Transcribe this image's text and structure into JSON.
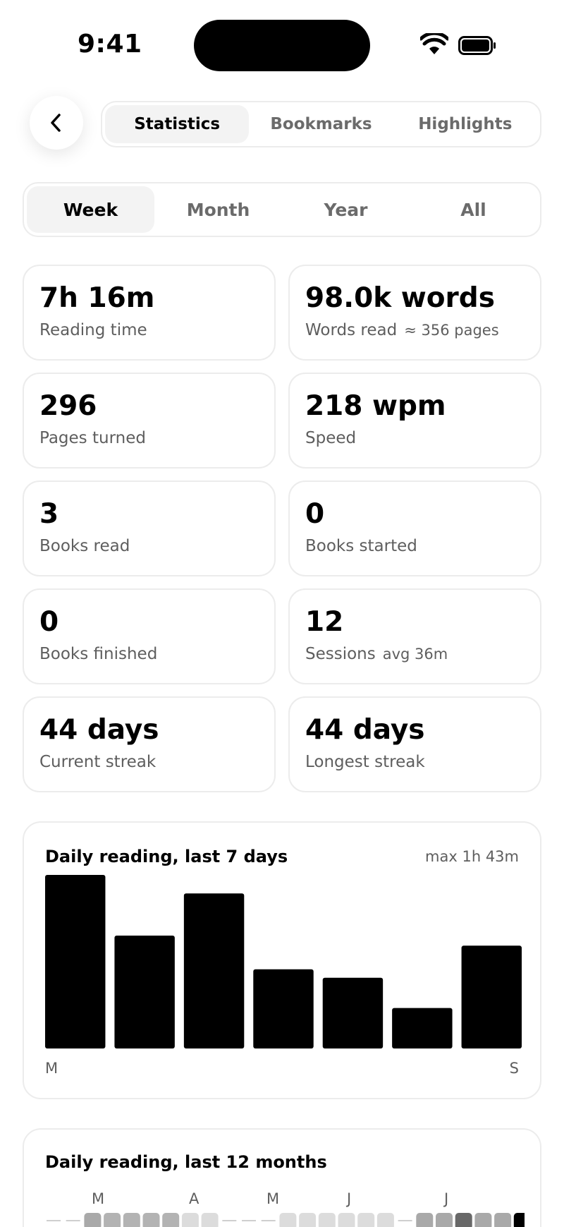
{
  "status_bar": {
    "time": "9:41"
  },
  "tabs": [
    {
      "label": "Statistics",
      "active": true
    },
    {
      "label": "Bookmarks",
      "active": false
    },
    {
      "label": "Highlights",
      "active": false
    }
  ],
  "periods": [
    {
      "label": "Week",
      "active": true
    },
    {
      "label": "Month",
      "active": false
    },
    {
      "label": "Year",
      "active": false
    },
    {
      "label": "All",
      "active": false
    }
  ],
  "stats": {
    "reading_time": {
      "value": "7h 16m",
      "label": "Reading time"
    },
    "words_read": {
      "value": "98.0k words",
      "label": "Words read",
      "sub": "≈ 356 pages"
    },
    "pages_turned": {
      "value": "296",
      "label": "Pages turned"
    },
    "speed": {
      "value": "218 wpm",
      "label": "Speed"
    },
    "books_read": {
      "value": "3",
      "label": "Books read"
    },
    "books_started": {
      "value": "0",
      "label": "Books started"
    },
    "books_finished": {
      "value": "0",
      "label": "Books finished"
    },
    "sessions": {
      "value": "12",
      "label": "Sessions",
      "sub": "avg 36m"
    },
    "current_streak": {
      "value": "44 days",
      "label": "Current streak"
    },
    "longest_streak": {
      "value": "44 days",
      "label": "Longest streak"
    }
  },
  "chart_data": {
    "type": "bar",
    "title": "Daily reading, last 7 days",
    "annotation": "max 1h 43m",
    "x_start_label": "M",
    "x_end_label": "S",
    "max_minutes": 103,
    "values_minutes": [
      103,
      67,
      92,
      47,
      42,
      24,
      61
    ],
    "bar_color": "#000000"
  },
  "heatmap": {
    "title": "Daily reading, last 12 months",
    "month_labels": [
      "M",
      "A",
      "M",
      "J",
      "J"
    ],
    "cells": [
      "dash",
      "dash",
      "#a9a9a9",
      "#b3b3b3",
      "#b3b3b3",
      "#b3b3b3",
      "#b3b3b3",
      "#dcdcdc",
      "#dcdcdc",
      "dash",
      "dash",
      "dash",
      "#dcdcdc",
      "#dcdcdc",
      "#dcdcdc",
      "#dcdcdc",
      "#dcdcdc",
      "#dcdcdc",
      "dash",
      "#a9a9a9",
      "#a9a9a9",
      "#686868",
      "#a9a9a9",
      "#a9a9a9",
      "#000000"
    ]
  }
}
